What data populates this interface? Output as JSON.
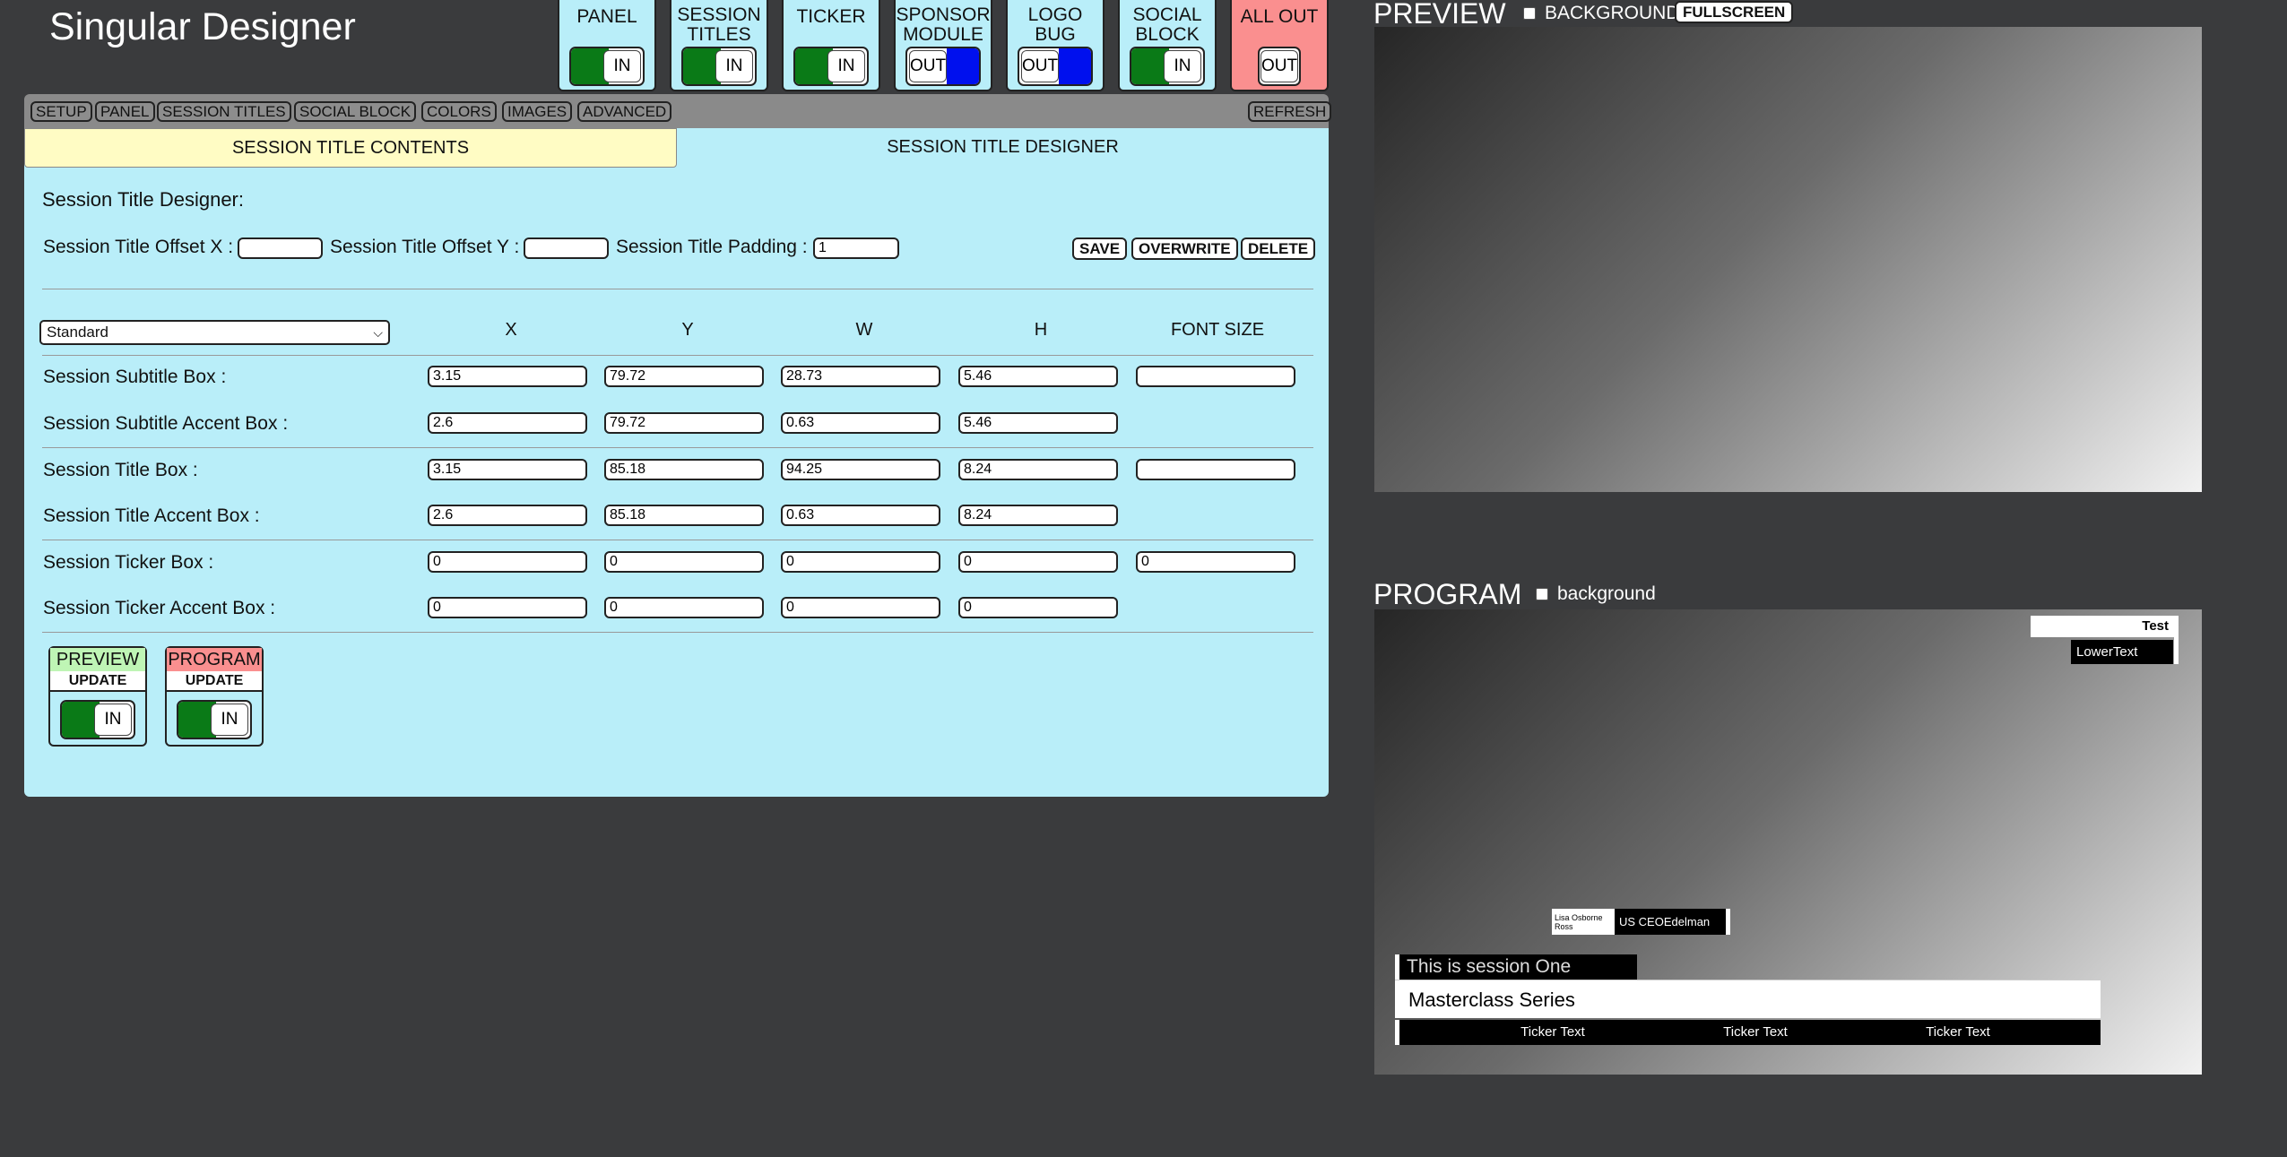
{
  "app": {
    "title": "Singular Designer"
  },
  "modules": [
    {
      "label": "PANEL",
      "state": "IN"
    },
    {
      "label": "SESSION TITLES",
      "state": "IN"
    },
    {
      "label": "TICKER",
      "state": "IN"
    },
    {
      "label": "SPONSOR MODULE",
      "state": "OUT"
    },
    {
      "label": "LOGO BUG",
      "state": "OUT"
    },
    {
      "label": "SOCIAL BLOCK",
      "state": "IN"
    },
    {
      "label": "ALL OUT",
      "state": "OUT"
    }
  ],
  "toolbar": {
    "buttons": [
      "SETUP",
      "PANEL",
      "SESSION TITLES",
      "SOCIAL BLOCK",
      "COLORS",
      "IMAGES",
      "ADVANCED"
    ],
    "refresh": "REFRESH"
  },
  "tabs": {
    "contents": "SESSION TITLE CONTENTS",
    "designer": "SESSION TITLE DESIGNER"
  },
  "designer": {
    "heading": "Session Title Designer:",
    "offset_x_label": "Session Title Offset X :",
    "offset_y_label": "Session Title Offset Y :",
    "padding_label": "Session Title Padding :",
    "offset_x": "",
    "offset_y": "",
    "padding": "1",
    "save": "SAVE",
    "overwrite": "OVERWRITE",
    "delete": "DELETE",
    "preset": "Standard",
    "columns": [
      "X",
      "Y",
      "W",
      "H",
      "FONT SIZE"
    ],
    "rows": [
      {
        "label": "Session Subtitle Box :",
        "values": [
          "3.15",
          "79.72",
          "28.73",
          "5.46",
          ""
        ]
      },
      {
        "label": "Session Subtitle Accent Box :",
        "values": [
          "2.6",
          "79.72",
          "0.63",
          "5.46"
        ]
      },
      {
        "label": "Session Title Box :",
        "values": [
          "3.15",
          "85.18",
          "94.25",
          "8.24",
          ""
        ]
      },
      {
        "label": "Session Title Accent Box :",
        "values": [
          "2.6",
          "85.18",
          "0.63",
          "8.24"
        ]
      },
      {
        "label": "Session Ticker Box :",
        "values": [
          "0",
          "0",
          "0",
          "0",
          "0"
        ]
      },
      {
        "label": "Session Ticker Accent Box :",
        "values": [
          "0",
          "0",
          "0",
          "0"
        ]
      }
    ]
  },
  "update": {
    "preview": {
      "label": "PREVIEW",
      "button": "UPDATE",
      "state": "IN",
      "color": "#bff5b5"
    },
    "program": {
      "label": "PROGRAM",
      "button": "UPDATE",
      "state": "IN",
      "color": "#fa8f8f"
    }
  },
  "preview": {
    "title": "PREVIEW",
    "checkbox": "BACKGROUND",
    "fullscreen": "FULLSCREEN"
  },
  "program": {
    "title": "PROGRAM",
    "checkbox": "background",
    "overlay": {
      "top_text": "Test",
      "lower_text": "LowerText",
      "social_name": "Lisa Osborne Ross",
      "social_title": "US CEOEdelman",
      "subtitle": "This is session One",
      "title": "Masterclass Series",
      "ticker": [
        "Ticker Text",
        "Ticker Text",
        "Ticker Text"
      ]
    }
  },
  "colors": {
    "panel": "#b9eef9",
    "in": "#0a7a17",
    "out": "#0010ee",
    "alert": "#fa8f8f",
    "active_tab": "#fffcc4"
  }
}
